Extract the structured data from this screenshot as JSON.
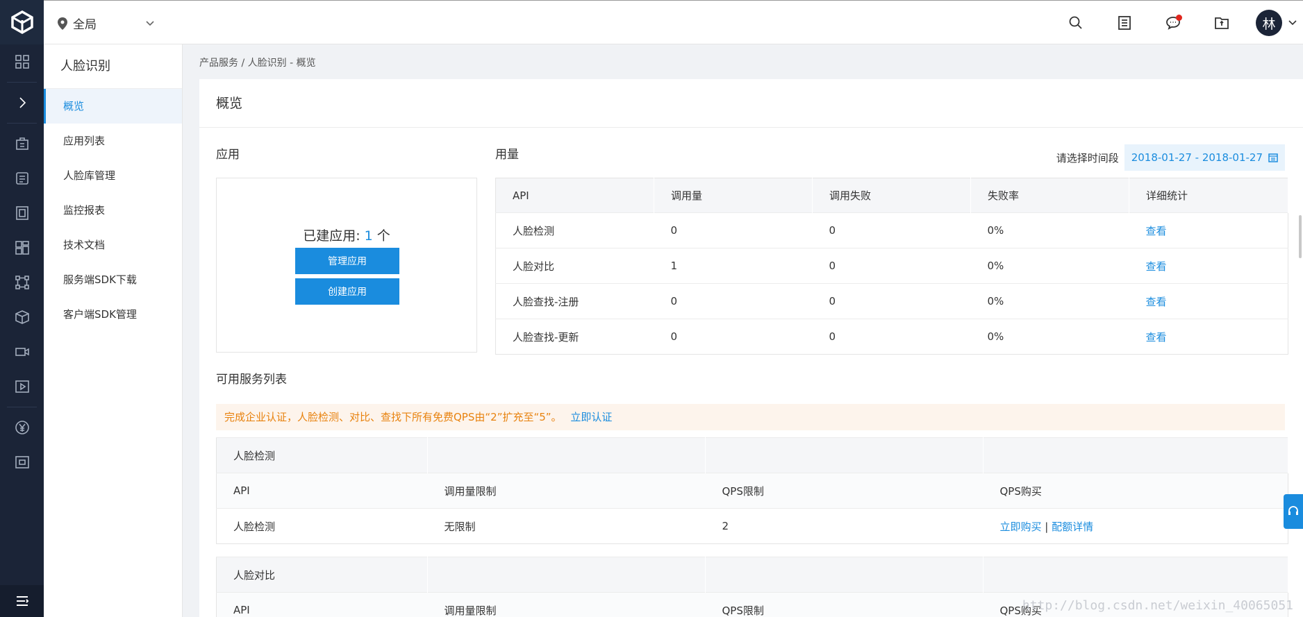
{
  "topbar": {
    "region": "全局",
    "avatar": "林",
    "icons": [
      "search-icon",
      "document-icon",
      "message-icon",
      "folder-icon"
    ]
  },
  "rail": {
    "icons": [
      "dashboard-icon",
      "expand-icon",
      "building-icon",
      "list-icon",
      "storage-icon",
      "grid-icon",
      "network-icon",
      "box-icon",
      "video-icon",
      "play-icon",
      "yuan-icon",
      "screen-icon",
      "menu-icon"
    ]
  },
  "subnav": {
    "title": "人脸识别",
    "items": [
      "概览",
      "应用列表",
      "人脸库管理",
      "监控报表",
      "技术文档",
      "服务端SDK下载",
      "客户端SDK管理"
    ]
  },
  "breadcrumb": "产品服务 / 人脸识别 - 概览",
  "overview": {
    "title": "概览",
    "app_section": "应用",
    "app_count_prefix": "已建应用: ",
    "app_count": "1",
    "app_count_suffix": " 个",
    "manage_btn": "管理应用",
    "create_btn": "创建应用",
    "usage_section": "用量",
    "date_label": "请选择时间段",
    "date_range": "2018-01-27 - 2018-01-27"
  },
  "usage_table": {
    "headers": [
      "API",
      "调用量",
      "调用失败",
      "失败率",
      "详细统计"
    ],
    "rows": [
      [
        "人脸检测",
        "0",
        "0",
        "0%",
        "查看"
      ],
      [
        "人脸对比",
        "1",
        "0",
        "0%",
        "查看"
      ],
      [
        "人脸查找-注册",
        "0",
        "0",
        "0%",
        "查看"
      ],
      [
        "人脸查找-更新",
        "0",
        "0",
        "0%",
        "查看"
      ]
    ]
  },
  "services": {
    "title": "可用服务列表",
    "notice": "完成企业认证，人脸检测、对比、查找下所有免费QPS由“2”扩充至“5”。",
    "notice_link": "立即认证",
    "sub_headers": [
      "API",
      "调用量限制",
      "QPS限制",
      "QPS购买"
    ],
    "groups": [
      {
        "name": "人脸检测",
        "rows": [
          [
            "人脸检测",
            "无限制",
            "2",
            "立即购买",
            "配额详情"
          ]
        ]
      },
      {
        "name": "人脸对比",
        "rows": []
      }
    ]
  },
  "watermark": "http://blog.csdn.net/weixin_40065051",
  "colors": {
    "accent": "#1a8cde",
    "rail": "#1b2437",
    "notice": "#e8820e"
  }
}
